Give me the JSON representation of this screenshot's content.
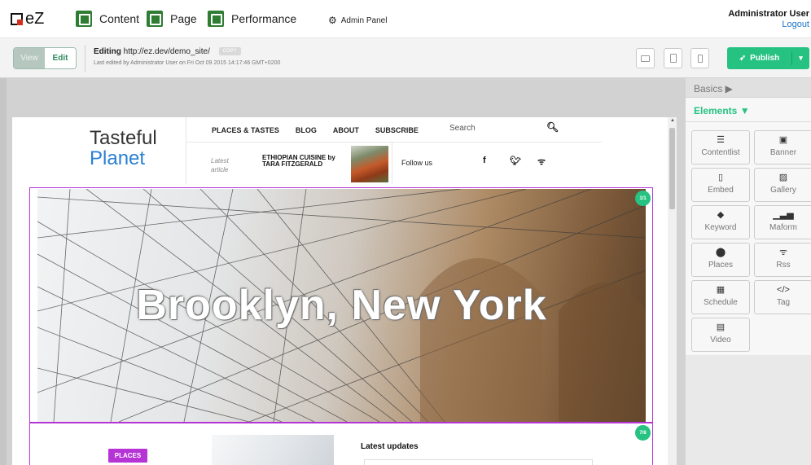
{
  "topbar": {
    "brand": "eZ",
    "nav": [
      {
        "label": "Content",
        "icon": "content-icon"
      },
      {
        "label": "Page",
        "icon": "page-icon"
      },
      {
        "label": "Performance",
        "icon": "performance-icon"
      }
    ],
    "admin_label": "Admin Panel",
    "user_name": "Administrator User",
    "logout_label": "Logout"
  },
  "toolbar": {
    "view_label": "View",
    "edit_label": "Edit",
    "editing_label": "Editing",
    "url": "http://ez.dev/demo_site/",
    "copy_label": "COPY",
    "last_edited": "Last edited by Administrator User on Fri Oct 09 2015 14:17:46 GMT+0200",
    "publish_label": "Publish",
    "accent_color": "#26c281"
  },
  "site": {
    "logo_line1": "Tasteful",
    "logo_line2": "Planet",
    "nav": [
      "PLACES & TASTES",
      "BLOG",
      "ABOUT",
      "SUBSCRIBE"
    ],
    "search_placeholder": "Search",
    "latest_label": "Latest article",
    "latest_article": "ETHIOPIAN CUISINE by TARA FITZGERALD",
    "follow_label": "Follow us",
    "social_icons": [
      "facebook-icon",
      "twitter-icon",
      "rss-icon"
    ],
    "hero_title": "Brooklyn, New York",
    "block_badges": [
      "1/1",
      "7/8"
    ],
    "places_tag": "PLACES",
    "updates_title": "Latest updates",
    "block_border_color": "#b634d6"
  },
  "sidebar": {
    "basics_label": "Basics ▶",
    "elements_label": "Elements ▼",
    "tiles": [
      {
        "label": "Contentlist",
        "icon": "contentlist-icon"
      },
      {
        "label": "Banner",
        "icon": "banner-icon"
      },
      {
        "label": "Embed",
        "icon": "embed-icon"
      },
      {
        "label": "Gallery",
        "icon": "gallery-icon"
      },
      {
        "label": "Keyword",
        "icon": "keyword-icon"
      },
      {
        "label": "Maform",
        "icon": "maform-icon"
      },
      {
        "label": "Places",
        "icon": "places-icon"
      },
      {
        "label": "Rss",
        "icon": "rss-icon"
      },
      {
        "label": "Schedule",
        "icon": "schedule-icon"
      },
      {
        "label": "Tag",
        "icon": "tag-icon"
      },
      {
        "label": "Video",
        "icon": "video-icon"
      }
    ]
  }
}
